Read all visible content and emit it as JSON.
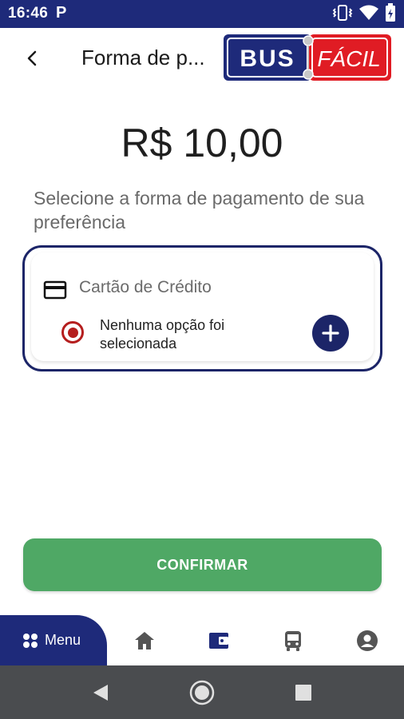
{
  "status_bar": {
    "time": "16:46",
    "app_badge": "P",
    "icons": [
      "vibrate-icon",
      "wifi-icon",
      "battery-icon"
    ]
  },
  "header": {
    "title": "Forma de p...",
    "back_icon": "chevron-left-icon",
    "logo": {
      "left_text": "BUS",
      "right_text": "FÁCIL",
      "colors": {
        "navy": "#1e2a7a",
        "red": "#e01c24"
      }
    }
  },
  "amount": "R$ 10,00",
  "instructions": "Selecione a forma de pagamento de sua preferência",
  "payment": {
    "method_label": "Cartão de Crédito",
    "method_icon": "credit-card-icon",
    "option_text": "Nenhuma opção foi selecionada",
    "option_selected": true,
    "add_icon": "plus-icon"
  },
  "confirm_label": "CONFIRMAR",
  "bottom_nav": {
    "menu_label": "Menu",
    "items": [
      {
        "icon": "home-icon"
      },
      {
        "icon": "wallet-icon",
        "active": true
      },
      {
        "icon": "bus-icon"
      },
      {
        "icon": "account-icon"
      }
    ]
  },
  "system_nav": [
    "back-triangle-icon",
    "home-circle-icon",
    "recents-square-icon"
  ],
  "colors": {
    "primary": "#1e2a7a",
    "accent_red": "#b51e1e",
    "confirm_green": "#4fa865",
    "system_nav": "#4a4c4f"
  }
}
